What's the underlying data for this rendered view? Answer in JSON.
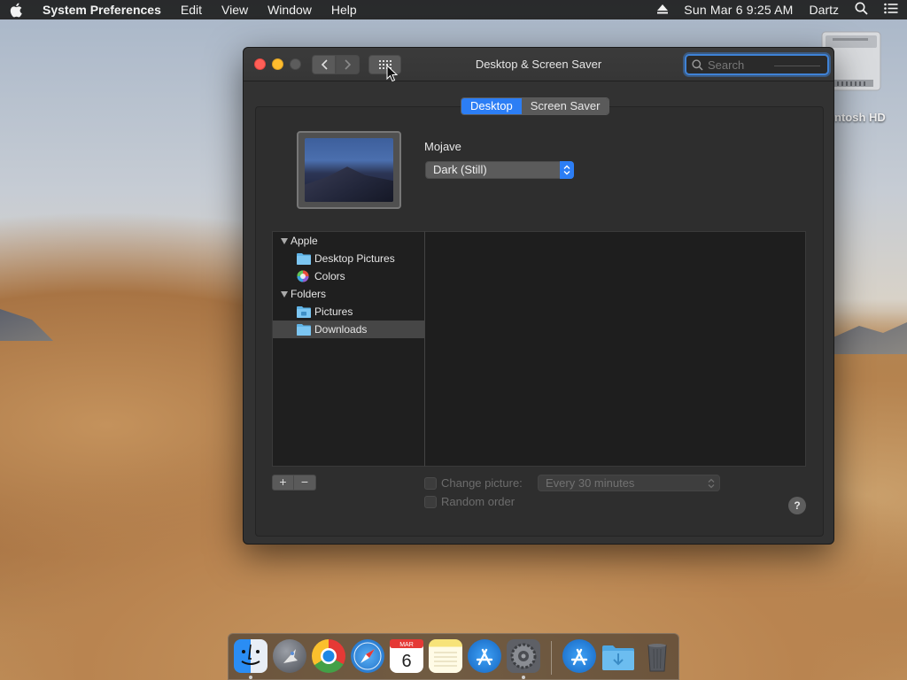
{
  "menubar": {
    "app_name": "System Preferences",
    "items": [
      "Edit",
      "View",
      "Window",
      "Help"
    ],
    "clock": "Sun Mar 6  9:25 AM",
    "user": "Dartz"
  },
  "desktop": {
    "disk_label": "ntosh HD"
  },
  "window": {
    "title": "Desktop & Screen Saver",
    "search_placeholder": "Search",
    "tabs": [
      "Desktop",
      "Screen Saver"
    ],
    "active_tab": "Desktop",
    "wallpaper_name": "Mojave",
    "style_value": "Dark (Still)",
    "source_list": {
      "groups": [
        {
          "label": "Apple",
          "items": [
            {
              "label": "Desktop Pictures",
              "icon": "folder-icon"
            },
            {
              "label": "Colors",
              "icon": "color-wheel-icon"
            }
          ]
        },
        {
          "label": "Folders",
          "items": [
            {
              "label": "Pictures",
              "icon": "pictures-folder-icon"
            },
            {
              "label": "Downloads",
              "icon": "downloads-folder-icon",
              "selected": true
            }
          ]
        }
      ]
    },
    "add_label": "+",
    "remove_label": "−",
    "change_picture_label": "Change picture:",
    "interval_value": "Every 30 minutes",
    "random_order_label": "Random order",
    "help_label": "?"
  },
  "dock": {
    "apps": [
      "finder-icon",
      "launchpad-icon",
      "chrome-icon",
      "safari-icon",
      "calendar-icon",
      "notes-icon",
      "app-store-icon",
      "system-preferences-icon",
      "applications-folder-icon",
      "downloads-stack-icon",
      "trash-icon"
    ],
    "calendar_month": "MAR",
    "calendar_day": "6"
  },
  "colors": {
    "accent": "#2c7ef5",
    "close": "#ff5f57",
    "minimize": "#febc2e"
  }
}
